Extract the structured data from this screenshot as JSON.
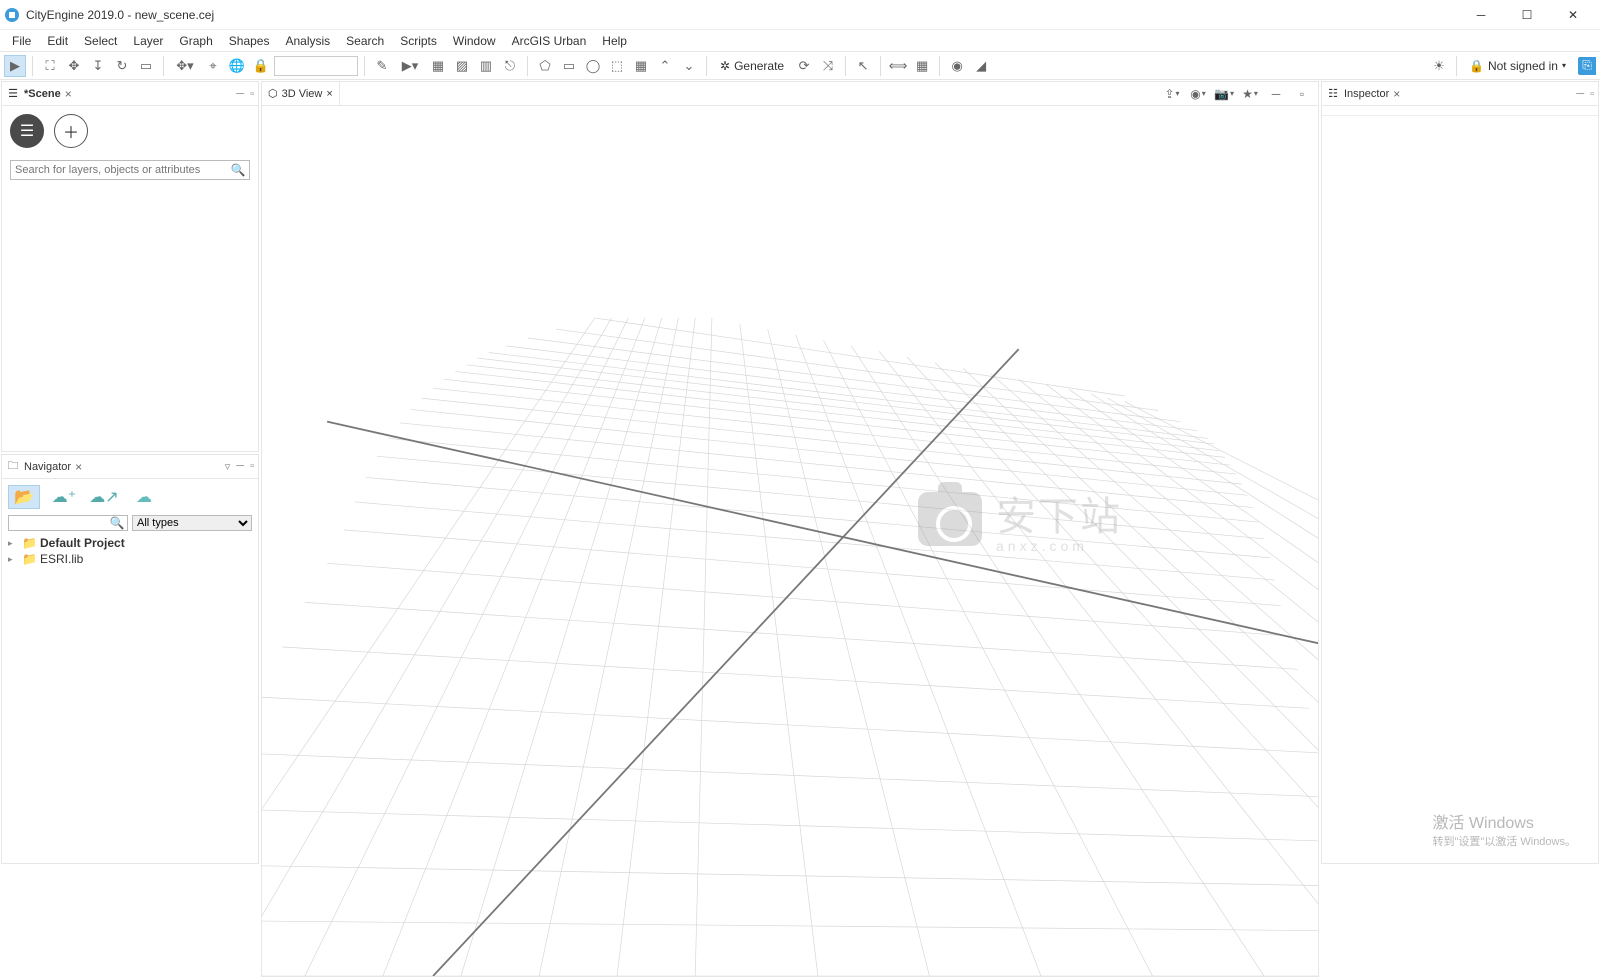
{
  "window": {
    "title": "CityEngine 2019.0 - new_scene.cej"
  },
  "menus": [
    "File",
    "Edit",
    "Select",
    "Layer",
    "Graph",
    "Shapes",
    "Analysis",
    "Search",
    "Scripts",
    "Window",
    "ArcGIS Urban",
    "Help"
  ],
  "toolbar": {
    "address_value": "",
    "generate_label": "Generate",
    "signin_label": "Not signed in"
  },
  "scene_panel": {
    "tab_label": "*Scene",
    "search_placeholder": "Search for layers, objects or attributes"
  },
  "navigator": {
    "tab_label": "Navigator",
    "filter_text": "",
    "type_filter": "All types",
    "tree": [
      {
        "label": "Default Project",
        "bold": true
      },
      {
        "label": "ESRI.lib",
        "bold": false
      }
    ]
  },
  "view3d": {
    "tab_label": "3D View"
  },
  "inspector": {
    "tab_label": "Inspector"
  },
  "watermark": {
    "text": "安下站",
    "sub": "anxz.com"
  },
  "activate": {
    "line1": "激活 Windows",
    "line2": "转到\"设置\"以激活 Windows。"
  }
}
